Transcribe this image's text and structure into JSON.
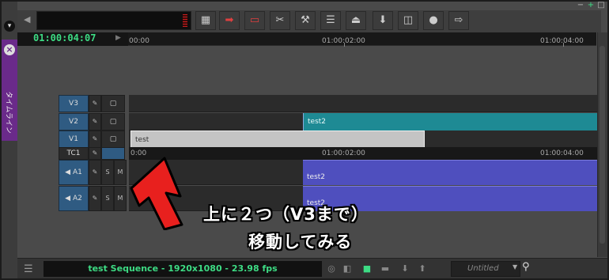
{
  "side_panel": {
    "label": "タイムライン"
  },
  "timecode": "01:00:04:07",
  "ruler": {
    "ticks": [
      "00:00",
      "01:00:02:00",
      "01:00:04:00"
    ]
  },
  "tracks": {
    "video": [
      {
        "name": "V3",
        "clip": ""
      },
      {
        "name": "V2",
        "clip": "test2"
      },
      {
        "name": "V1",
        "clip": "test"
      }
    ],
    "tc": {
      "name": "TC1",
      "ticks": [
        "0:00",
        "01:00:02:00",
        "01:00:04:00"
      ]
    },
    "audio": [
      {
        "name": "A1",
        "solo": "S",
        "mute": "M",
        "clip": "test2"
      },
      {
        "name": "A2",
        "solo": "S",
        "mute": "M",
        "clip": "test2"
      }
    ]
  },
  "annotation": {
    "line1": "上に２つ（V3まで）",
    "line2": "移動してみる",
    "arrow_color": "#e8201e"
  },
  "status_bar": {
    "sequence_info": "test Sequence - 1920x1080 - 23.98 fps",
    "bin_select": "Untitled"
  },
  "colors": {
    "timecode_green": "#3ddc84",
    "video_clip_teal": "#1e8a94",
    "audio_clip_purple": "#4f4fbe",
    "panel_purple": "#6a2a8a",
    "track_header_blue": "#2f5b82"
  }
}
